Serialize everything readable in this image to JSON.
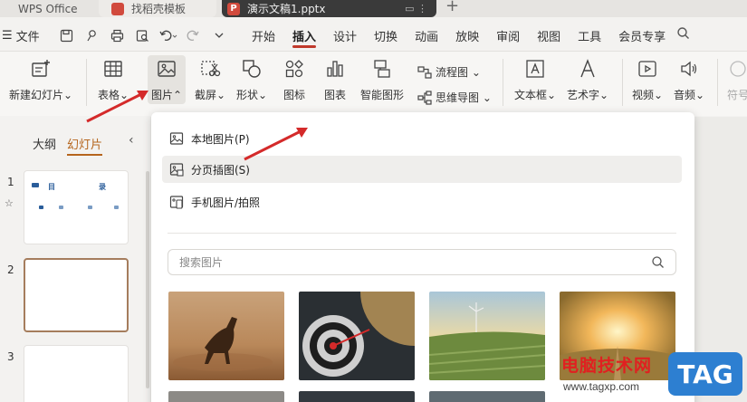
{
  "tabs": [
    {
      "label": "WPS Office"
    },
    {
      "label": "找稻壳模板"
    },
    {
      "label": "演示文稿1.pptx"
    }
  ],
  "menubar": {
    "file_label": "文件",
    "items": [
      "开始",
      "插入",
      "设计",
      "切换",
      "动画",
      "放映",
      "审阅",
      "视图",
      "工具",
      "会员专享"
    ],
    "active": "插入"
  },
  "ribbon": {
    "new_slide": "新建幻灯片",
    "table": "表格",
    "picture": "图片",
    "screenshot": "截屏",
    "shape": "形状",
    "icon": "图标",
    "chart": "图表",
    "smartart": "智能图形",
    "flowchart": "流程图",
    "mindmap": "思维导图",
    "textbox": "文本框",
    "wordart": "艺术字",
    "video": "视频",
    "audio": "音频",
    "symbol": "符号"
  },
  "left_panel": {
    "tab_outline": "大纲",
    "tab_slides": "幻灯片",
    "slide_numbers": [
      "1",
      "2",
      "3"
    ],
    "thumb1_title_a": "目",
    "thumb1_title_b": "录"
  },
  "dropdown": {
    "items": [
      {
        "label": "本地图片(P)"
      },
      {
        "label": "分页插图(S)"
      },
      {
        "label": "手机图片/拍照"
      }
    ],
    "search_placeholder": "搜索图片"
  },
  "watermark": {
    "text": "电脑技术网",
    "url": "www.tagxp.com",
    "tag": "TAG"
  },
  "colors": {
    "accent": "#c0392b",
    "arrow": "#d42a2a",
    "selected_tab": "#b5651d"
  }
}
